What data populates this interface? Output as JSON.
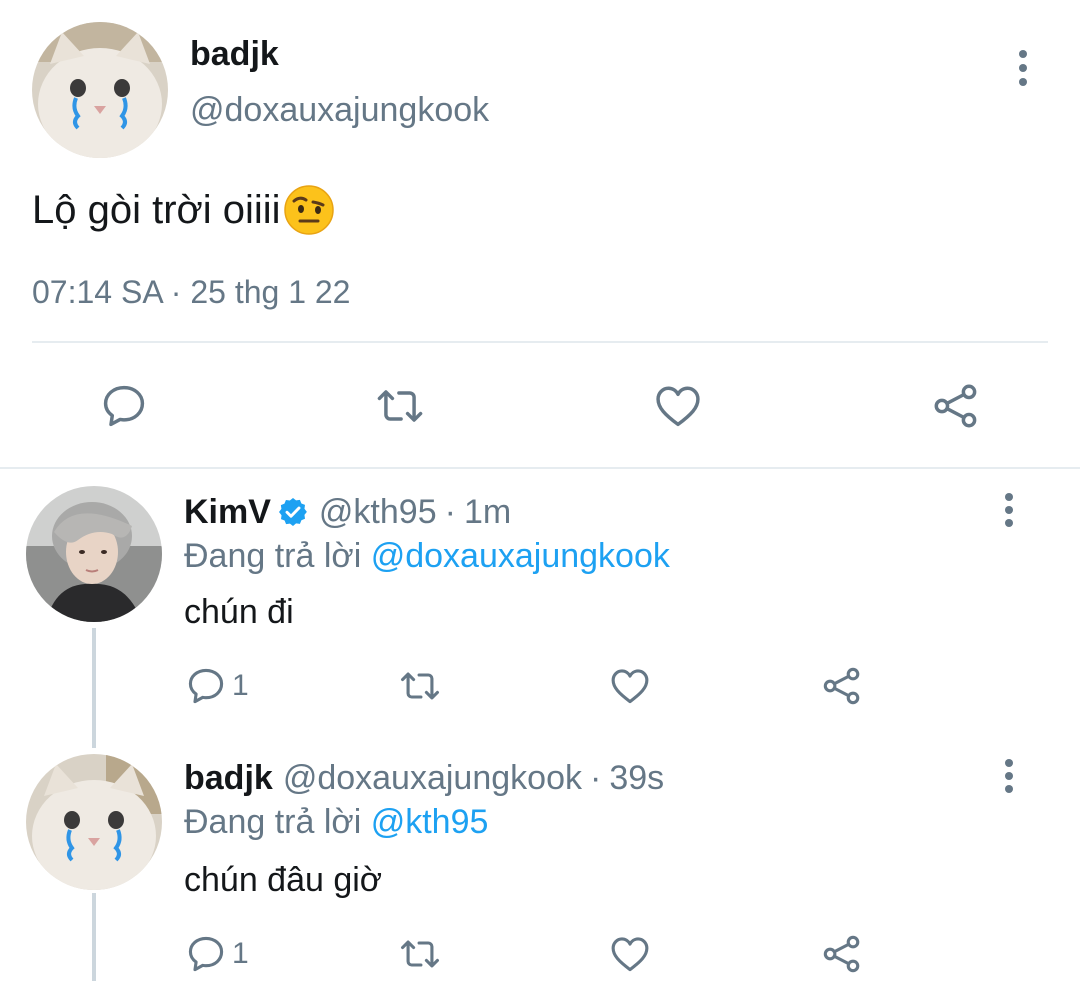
{
  "main_tweet": {
    "name": "badjk",
    "handle": "@doxauxajungkook",
    "text": "Lộ gòi trời oiiii",
    "emoji": "face-with-raised-eyebrow-emoji",
    "time": "07:14 SA",
    "separator": "·",
    "date": "25 thg 1 22",
    "actions": [
      "reply-icon",
      "retweet-icon",
      "like-icon",
      "share-icon"
    ]
  },
  "replies": [
    {
      "name": "KimV",
      "verified": true,
      "handle": "@kth95",
      "time": "1m",
      "separator": "·",
      "replying_prefix": "Đang trả lời",
      "replying_to": "@doxauxajungkook",
      "text": "chún đi",
      "reply_count": "1"
    },
    {
      "name": "badjk",
      "verified": false,
      "handle": "@doxauxajungkook",
      "time": "39s",
      "separator": "·",
      "replying_prefix": "Đang trả lời",
      "replying_to": "@kth95",
      "text": "chún đâu giờ",
      "reply_count": "1"
    }
  ],
  "colors": {
    "text_primary": "#14171a",
    "text_secondary": "#657786",
    "link": "#1da1f2",
    "icon": "#657786",
    "divider": "#e6ecf0"
  }
}
